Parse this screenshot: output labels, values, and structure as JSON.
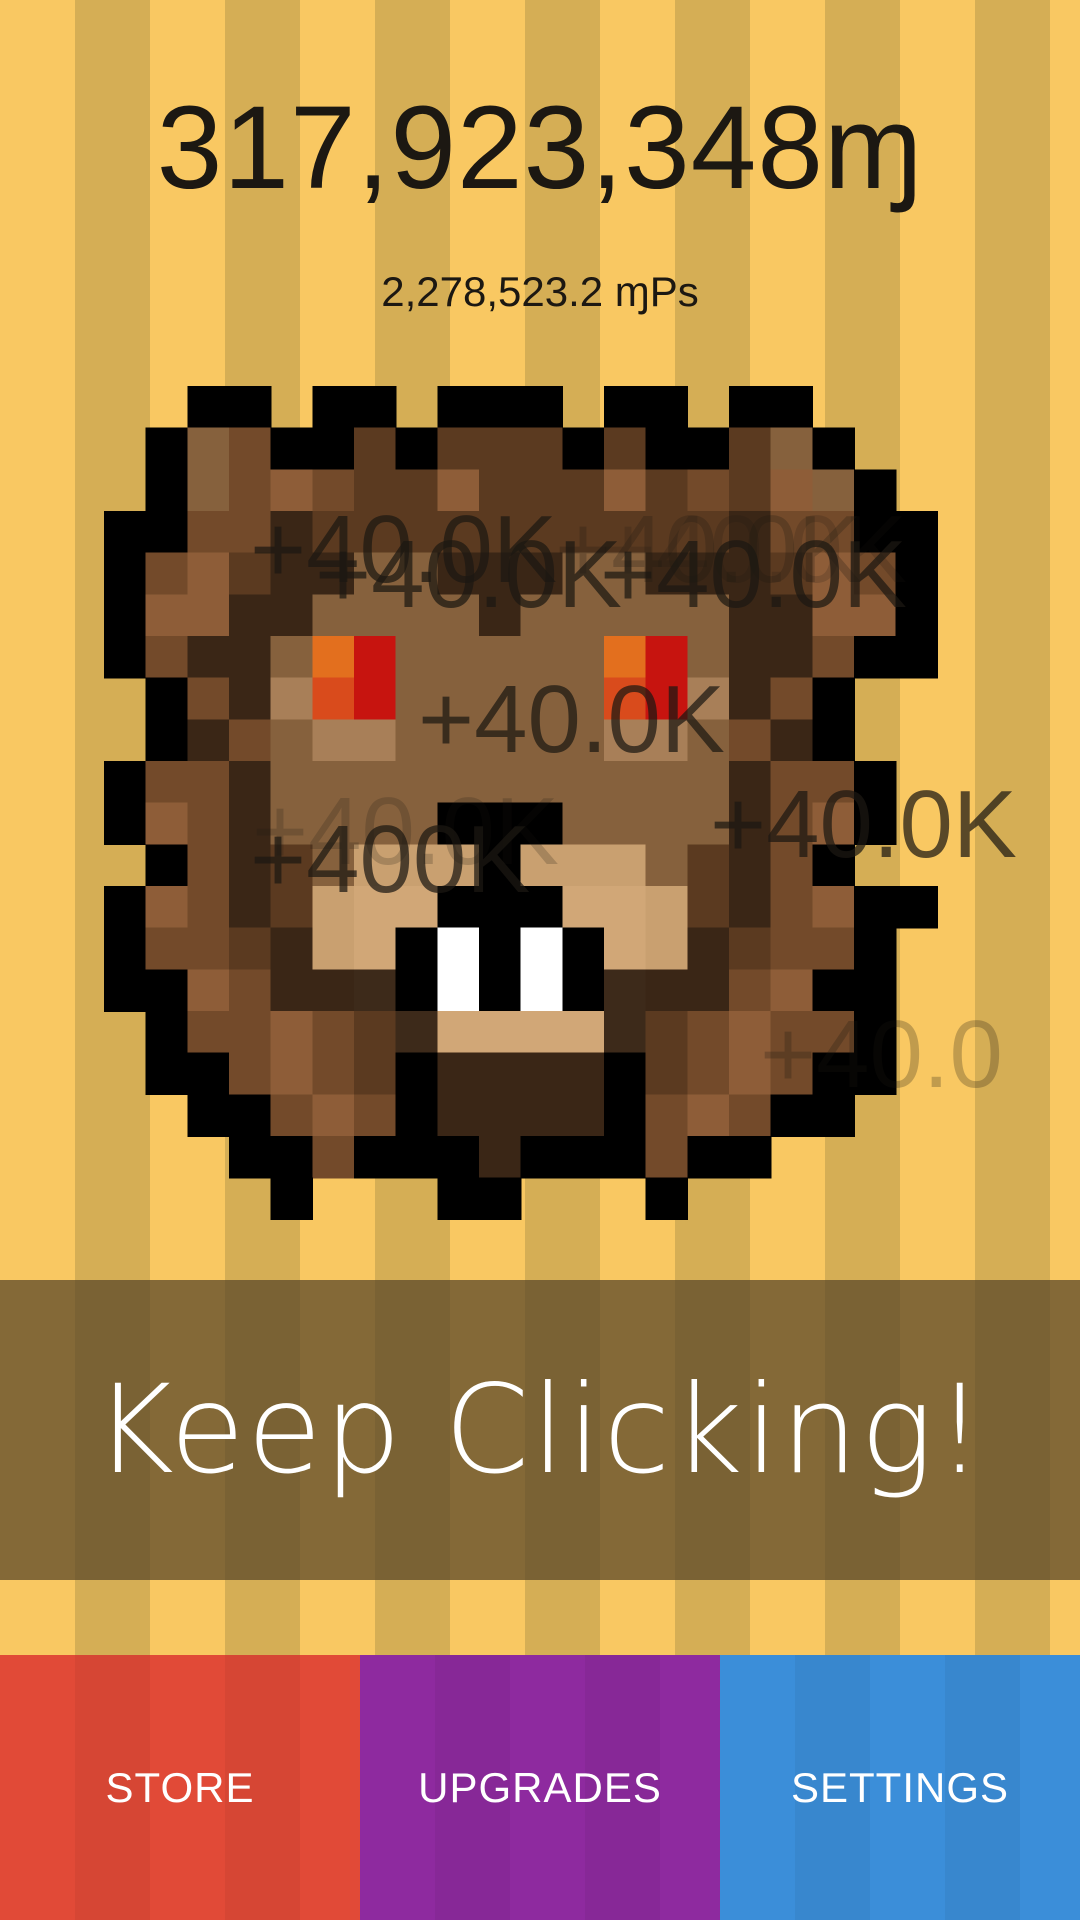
{
  "score": {
    "value": "317,923,348ɱ"
  },
  "rate": {
    "value": "2,278,523.2 ɱPs"
  },
  "floating_labels": [
    {
      "text": "+40.0K",
      "opacity": 0.72
    },
    {
      "text": "+40.0K",
      "opacity": 0.25
    },
    {
      "text": "+40.0K",
      "opacity": 0.72
    },
    {
      "text": "+40.0K",
      "opacity": 0.18
    },
    {
      "text": "+40.0K",
      "opacity": 0.72
    },
    {
      "text": "+40.0K",
      "opacity": 0.72
    },
    {
      "text": "+40.0K",
      "opacity": 0.2
    },
    {
      "text": "+400K",
      "opacity": 0.72
    },
    {
      "text": "+40.0K",
      "opacity": 0.72
    },
    {
      "text": "+40.0",
      "opacity": 0.25
    }
  ],
  "banner": {
    "text": "Keep Clicking!"
  },
  "nav": {
    "store": {
      "label": "STORE",
      "color": "#e14a37"
    },
    "upgrades": {
      "label": "UPGRADES",
      "color": "#8e2a9f"
    },
    "settings": {
      "label": "SETTINGS",
      "color": "#3b8ed9"
    }
  },
  "colors": {
    "stripe_light": "#f9c862",
    "stripe_dark": "#d5ae55",
    "text_dark": "#1c1812"
  },
  "creature_icon": "lion-face-pixel-art-icon"
}
